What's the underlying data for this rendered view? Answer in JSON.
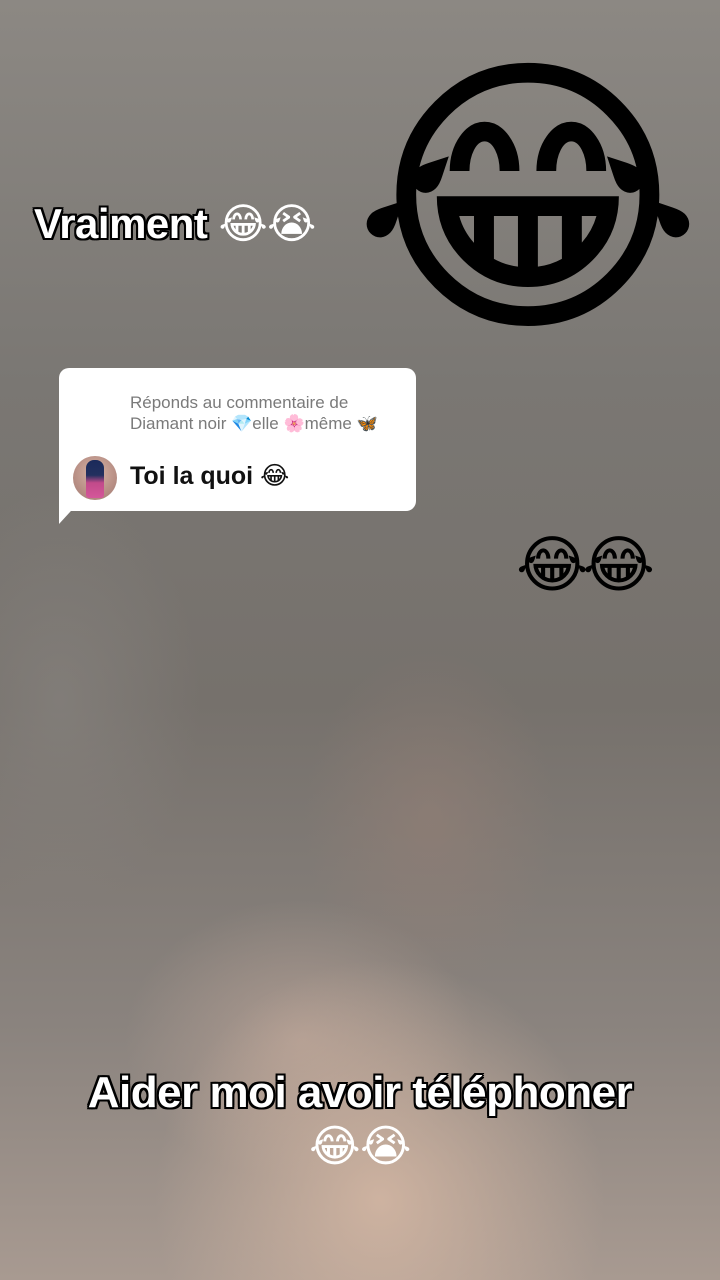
{
  "top_caption": {
    "text": "Vraiment",
    "emojis": "😂😭"
  },
  "big_emoji": "😂",
  "reply_card": {
    "header": "Réponds au commentaire de Diamant noir 💎elle 🌸même 🦋",
    "comment": "Toi la quoi 😂"
  },
  "side_emojis": "😂😂",
  "bottom_caption": {
    "text": "Aider moi avoir téléphoner",
    "emojis": "😂😭"
  }
}
